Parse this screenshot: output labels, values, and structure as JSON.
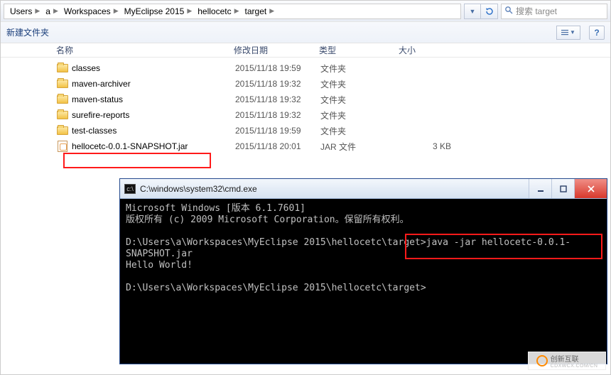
{
  "breadcrumbs": [
    "Users",
    "a",
    "Workspaces",
    "MyEclipse 2015",
    "hellocetc",
    "target"
  ],
  "search_placeholder": "搜索 target",
  "subbar": {
    "new_folder": "新建文件夹",
    "help": "?"
  },
  "columns": {
    "name": "名称",
    "date": "修改日期",
    "type": "类型",
    "size": "大小"
  },
  "files": [
    {
      "icon": "folder",
      "name": "classes",
      "date": "2015/11/18 19:59",
      "type": "文件夹",
      "size": ""
    },
    {
      "icon": "folder",
      "name": "maven-archiver",
      "date": "2015/11/18 19:32",
      "type": "文件夹",
      "size": ""
    },
    {
      "icon": "folder",
      "name": "maven-status",
      "date": "2015/11/18 19:32",
      "type": "文件夹",
      "size": ""
    },
    {
      "icon": "folder",
      "name": "surefire-reports",
      "date": "2015/11/18 19:32",
      "type": "文件夹",
      "size": ""
    },
    {
      "icon": "folder",
      "name": "test-classes",
      "date": "2015/11/18 19:59",
      "type": "文件夹",
      "size": ""
    },
    {
      "icon": "jar",
      "name": "hellocetc-0.0.1-SNAPSHOT.jar",
      "date": "2015/11/18 20:01",
      "type": "JAR 文件",
      "size": "3 KB"
    }
  ],
  "cmd": {
    "title": "C:\\windows\\system32\\cmd.exe",
    "lines": [
      "Microsoft Windows [版本 6.1.7601]",
      "版权所有 (c) 2009 Microsoft Corporation。保留所有权利。",
      "",
      "D:\\Users\\a\\Workspaces\\MyEclipse 2015\\hellocetc\\target>java -jar hellocetc-0.0.1-",
      "SNAPSHOT.jar",
      "Hello World!",
      "",
      "D:\\Users\\a\\Workspaces\\MyEclipse 2015\\hellocetc\\target>"
    ]
  },
  "watermark": {
    "brand": "创新互联",
    "sub": "CDXWCX.COM/CN"
  }
}
